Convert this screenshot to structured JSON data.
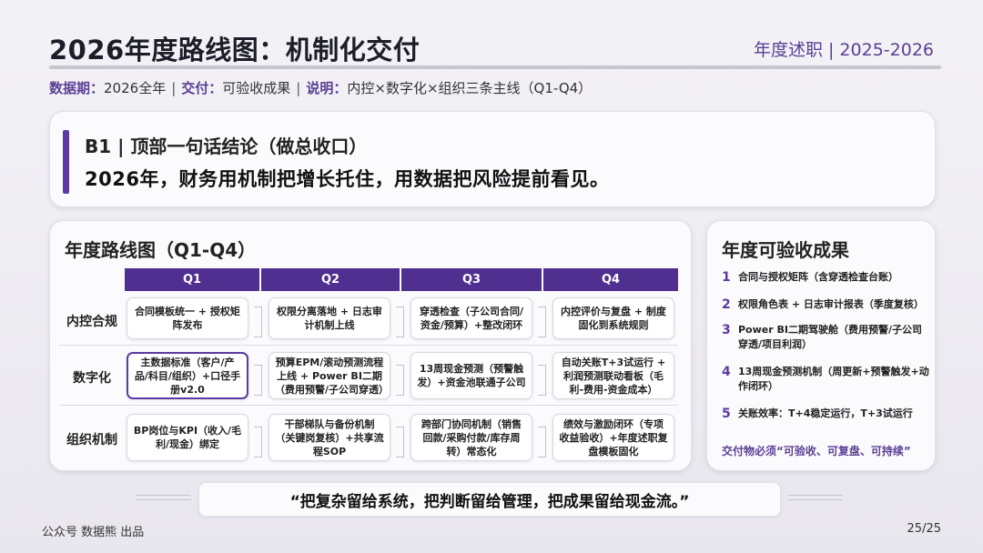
{
  "header": {
    "title": "2026年度路线图：机制化交付",
    "top_right": "年度述职 | 2025-2026"
  },
  "meta": {
    "k1": "数据期：",
    "v1": "2026全年",
    "k2": "交付：",
    "v2": "可验收成果",
    "k3": "说明：",
    "v3": "内控×数字化×组织三条主线（Q1-Q4）",
    "sep": "|"
  },
  "b1": {
    "heading": "B1 | 顶部一句话结论（做总收口）",
    "body": "2026年，财务用机制把增长托住，用数据把风险提前看见。"
  },
  "roadmap": {
    "heading": "年度路线图（Q1-Q4）",
    "quarters": [
      "Q1",
      "Q2",
      "Q3",
      "Q4"
    ],
    "rows": [
      {
        "label": "内控合规",
        "cells": [
          "合同模板统一 + 授权矩阵发布",
          "权限分离落地 + 日志审计机制上线",
          "穿透检查（子公司合同/资金/预算）+整改闭环",
          "内控评价与复盘 + 制度固化到系统规则"
        ]
      },
      {
        "label": "数字化",
        "cells": [
          "主数据标准（客户/产品/科目/组织）+口径手册v2.0",
          "预算EPM/滚动预测流程上线 + Power BI二期（费用预警/子公司穿透）",
          "13周现金预测（预警触发）+资金池联通子公司",
          "自动关账T+3试运行 + 利润预测联动看板（毛利-费用-资金成本）"
        ]
      },
      {
        "label": "组织机制",
        "cells": [
          "BP岗位与KPI（收入/毛利/现金）绑定",
          "干部梯队与备份机制（关键岗复核）+共享流程SOP",
          "跨部门协同机制（销售回款/采购付款/库存周转）常态化",
          "绩效与激励闭环（专项收益验收）+年度述职复盘模板固化"
        ]
      }
    ]
  },
  "acceptance": {
    "heading": "年度可验收成果",
    "items": [
      {
        "n": "1",
        "t": "合同与授权矩阵（含穿透检查台账）"
      },
      {
        "n": "2",
        "t": "权限角色表 + 日志审计报表（季度复核）"
      },
      {
        "n": "3",
        "t": "Power BI二期驾驶舱（费用预警/子公司穿透/项目利润）"
      },
      {
        "n": "4",
        "t": "13周现金预测机制（周更新+预警触发+动作闭环）"
      },
      {
        "n": "5",
        "t": "关账效率：T+4稳定运行，T+3试运行"
      }
    ],
    "footer": "交付物必须“可验收、可复盘、可持续”"
  },
  "quote": "“把复杂留给系统，把判断留给管理，把成果留给现金流。”",
  "footer": {
    "left": "公众号 数据熊 出品",
    "right": "25/25"
  },
  "colors": {
    "accent": "#5c3aa1",
    "header_bar": "#4f2f8f"
  }
}
